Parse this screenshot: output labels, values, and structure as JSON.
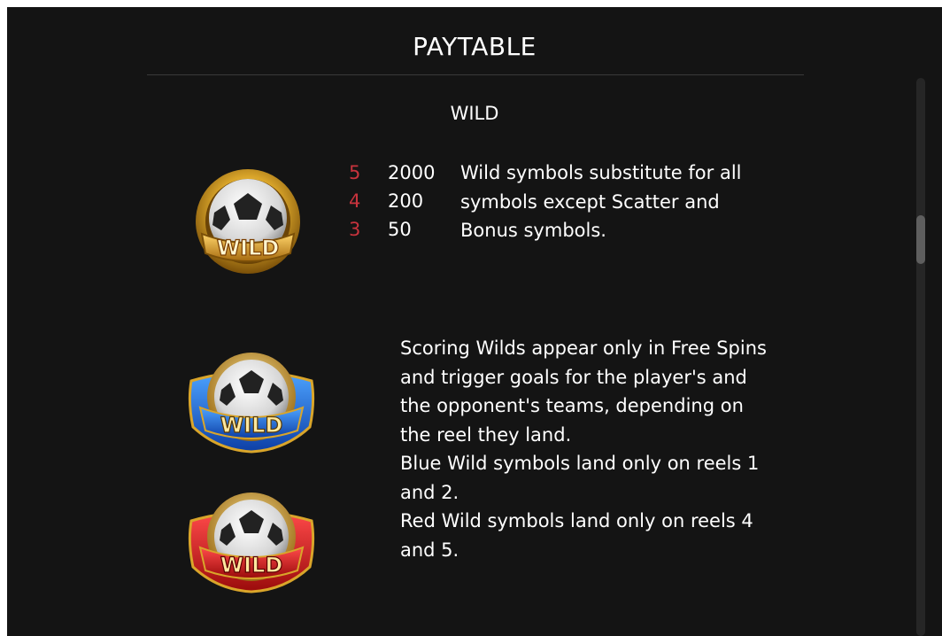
{
  "title": "PAYTABLE",
  "section_title": "WILD",
  "wild_payouts": [
    {
      "count": "5",
      "value": "2000"
    },
    {
      "count": "4",
      "value": "200"
    },
    {
      "count": "3",
      "value": "50"
    }
  ],
  "wild_description": [
    "Wild symbols substitute for all",
    "symbols except Scatter and",
    "Bonus symbols."
  ],
  "scoring_description": [
    "Scoring Wilds appear only in Free Spins",
    "and trigger goals for the player's and",
    "the opponent's teams, depending on",
    "the reel they land.",
    "Blue Wild symbols land only on reels 1",
    "and 2.",
    "Red Wild symbols land only on reels 4",
    "and 5."
  ],
  "symbols": {
    "gold": {
      "label": "WILD",
      "icon": "soccer-ball-wild-gold-icon"
    },
    "blue": {
      "label": "WILD",
      "icon": "soccer-ball-wild-blue-icon"
    },
    "red": {
      "label": "WILD",
      "icon": "soccer-ball-wild-red-icon"
    }
  },
  "colors": {
    "background": "#141414",
    "count_color": "#c8333d",
    "text": "#ffffff"
  }
}
